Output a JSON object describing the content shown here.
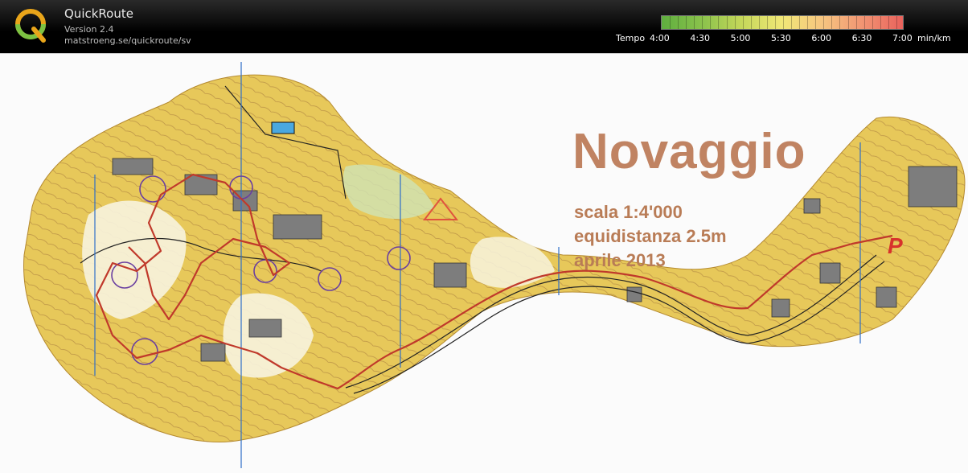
{
  "app": {
    "title": "QuickRoute",
    "version": "Version 2.4",
    "url": "matstroeng.se/quickroute/sv"
  },
  "pace_legend": {
    "label": "Tempo",
    "ticks": [
      "4:00",
      "4:30",
      "5:00",
      "5:30",
      "6:00",
      "6:30",
      "7:00"
    ],
    "unit": "min/km",
    "colors": [
      "#5fae3f",
      "#8bc24c",
      "#c5d75a",
      "#f1e777",
      "#f6c480",
      "#f19272",
      "#e9625c"
    ]
  },
  "map": {
    "title": "Novaggio",
    "scale": "scala 1:4'000",
    "contour": "equidistanza 2.5m",
    "date": "aprile 2013",
    "parking_symbol": "P",
    "colors": {
      "terrain": "#e7c85a",
      "open": "#f2db78",
      "forest": "#f7f3de",
      "route": "#c0392b",
      "building": "#7d7d7d",
      "north_lines": "#2f6fc9",
      "course": "#e0533e",
      "title": "#c08362"
    }
  }
}
